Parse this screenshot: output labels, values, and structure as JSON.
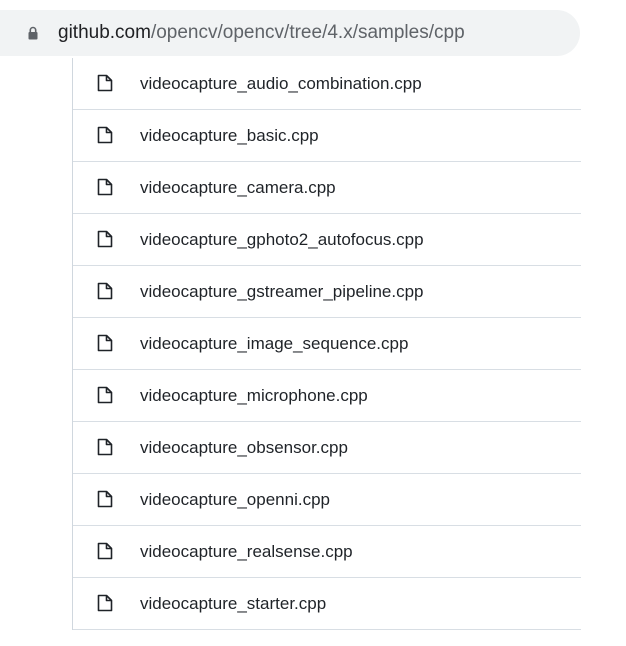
{
  "address_bar": {
    "host": "github.com",
    "path": "/opencv/opencv/tree/4.x/samples/cpp",
    "lock_icon": "lock-icon"
  },
  "files": [
    {
      "name": "videocapture_audio_combination.cpp",
      "icon": "file-icon"
    },
    {
      "name": "videocapture_basic.cpp",
      "icon": "file-icon"
    },
    {
      "name": "videocapture_camera.cpp",
      "icon": "file-icon"
    },
    {
      "name": "videocapture_gphoto2_autofocus.cpp",
      "icon": "file-icon"
    },
    {
      "name": "videocapture_gstreamer_pipeline.cpp",
      "icon": "file-icon"
    },
    {
      "name": "videocapture_image_sequence.cpp",
      "icon": "file-icon"
    },
    {
      "name": "videocapture_microphone.cpp",
      "icon": "file-icon"
    },
    {
      "name": "videocapture_obsensor.cpp",
      "icon": "file-icon"
    },
    {
      "name": "videocapture_openni.cpp",
      "icon": "file-icon"
    },
    {
      "name": "videocapture_realsense.cpp",
      "icon": "file-icon"
    },
    {
      "name": "videocapture_starter.cpp",
      "icon": "file-icon"
    }
  ],
  "colors": {
    "address_bar_bg": "#f1f3f4",
    "url_host": "#202124",
    "url_path": "#5f6368",
    "row_divider": "#d8dee4",
    "icon": "#1f2328"
  }
}
